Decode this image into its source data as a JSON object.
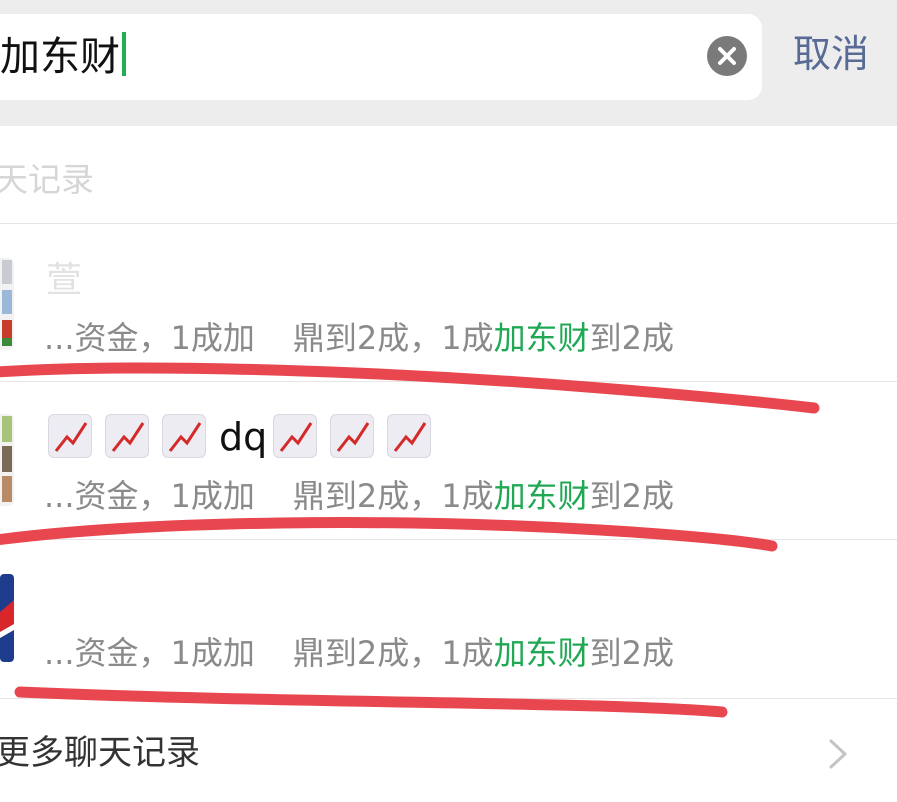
{
  "search": {
    "query": "加东财",
    "cancel_label": "取消"
  },
  "section": {
    "title": "聊天记录"
  },
  "results": [
    {
      "name": "萱",
      "snippet_before": "...资金，1成加",
      "snippet_middle": "鼎到2成，1成",
      "snippet_highlight": "加东财",
      "snippet_after": "到2成"
    },
    {
      "name": "dq",
      "name_emoji": "chart-increasing-icon",
      "snippet_before": "...资金，1成加",
      "snippet_middle": "鼎到2成，1成",
      "snippet_highlight": "加东财",
      "snippet_after": "到2成"
    },
    {
      "name": "",
      "snippet_before": "...资金，1成加",
      "snippet_middle": "鼎到2成，1成",
      "snippet_highlight": "加东财",
      "snippet_after": "到2成"
    }
  ],
  "footer": {
    "more_label": "更多聊天记录"
  },
  "colors": {
    "highlight": "#20a855",
    "cancel": "#576b95",
    "annotation": "#e8474f"
  }
}
